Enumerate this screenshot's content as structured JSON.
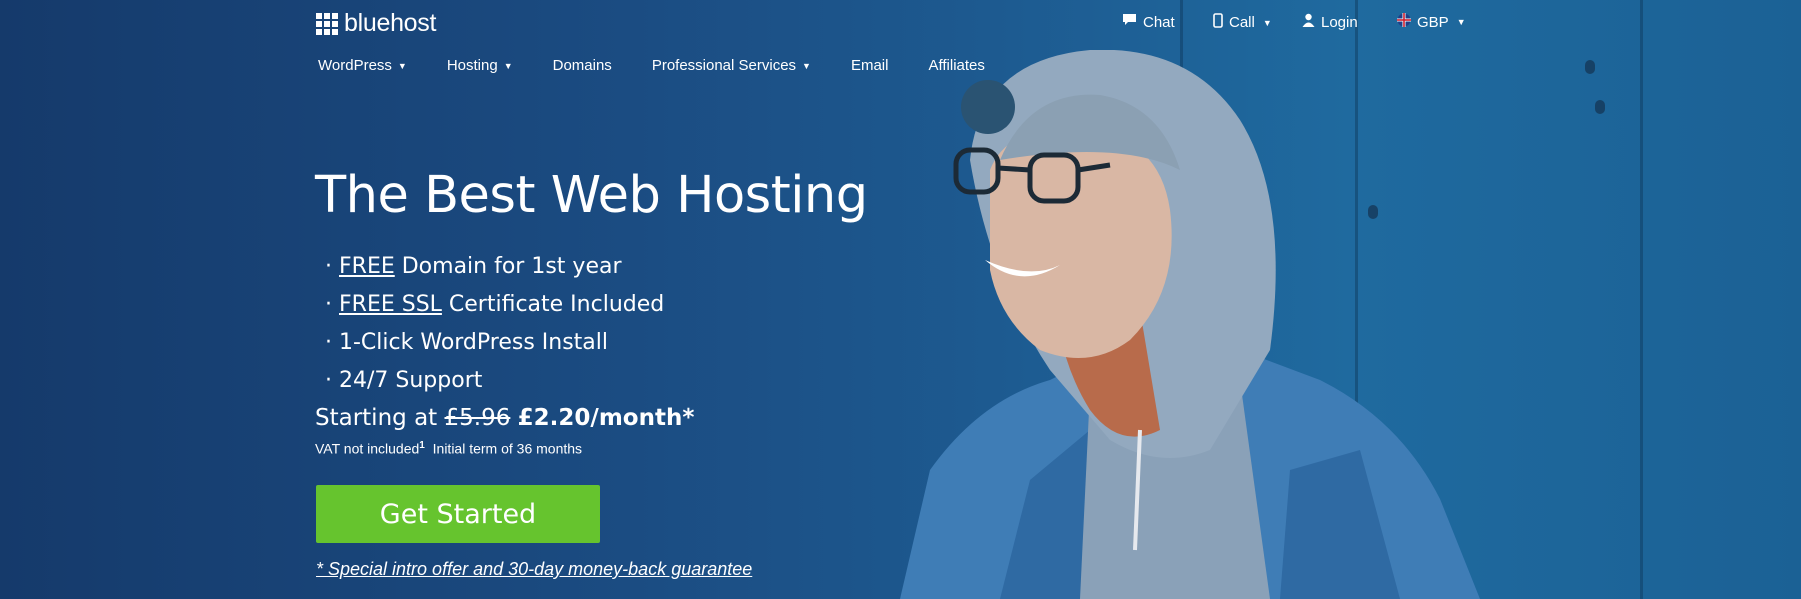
{
  "brand": {
    "name": "bluehost"
  },
  "utility_nav": {
    "chat": "Chat",
    "call": "Call",
    "login": "Login",
    "currency": "GBP"
  },
  "main_nav": [
    {
      "label": "WordPress",
      "has_dropdown": true
    },
    {
      "label": "Hosting",
      "has_dropdown": true
    },
    {
      "label": "Domains",
      "has_dropdown": false
    },
    {
      "label": "Professional Services",
      "has_dropdown": true
    },
    {
      "label": "Email",
      "has_dropdown": false
    },
    {
      "label": "Affiliates",
      "has_dropdown": false
    }
  ],
  "hero": {
    "headline": "The Best Web Hosting",
    "features": {
      "f1_link": "FREE",
      "f1_rest": " Domain for 1st year",
      "f2_link": "FREE SSL",
      "f2_rest": " Certificate Included",
      "f3": "1-Click WordPress Install",
      "f4": "24/7 Support"
    },
    "price_prefix": "Starting at",
    "old_price": "£5.96",
    "new_price": "£2.20/month*",
    "vat_note": "VAT not included",
    "vat_footnote": "1",
    "term_note": "Initial term of 36 months",
    "cta_label": "Get Started",
    "offer_text": "* Special intro offer and 30-day money-back guarantee"
  },
  "colors": {
    "background": "#1d4d82",
    "cta_green": "#66c42e",
    "text": "#ffffff"
  }
}
